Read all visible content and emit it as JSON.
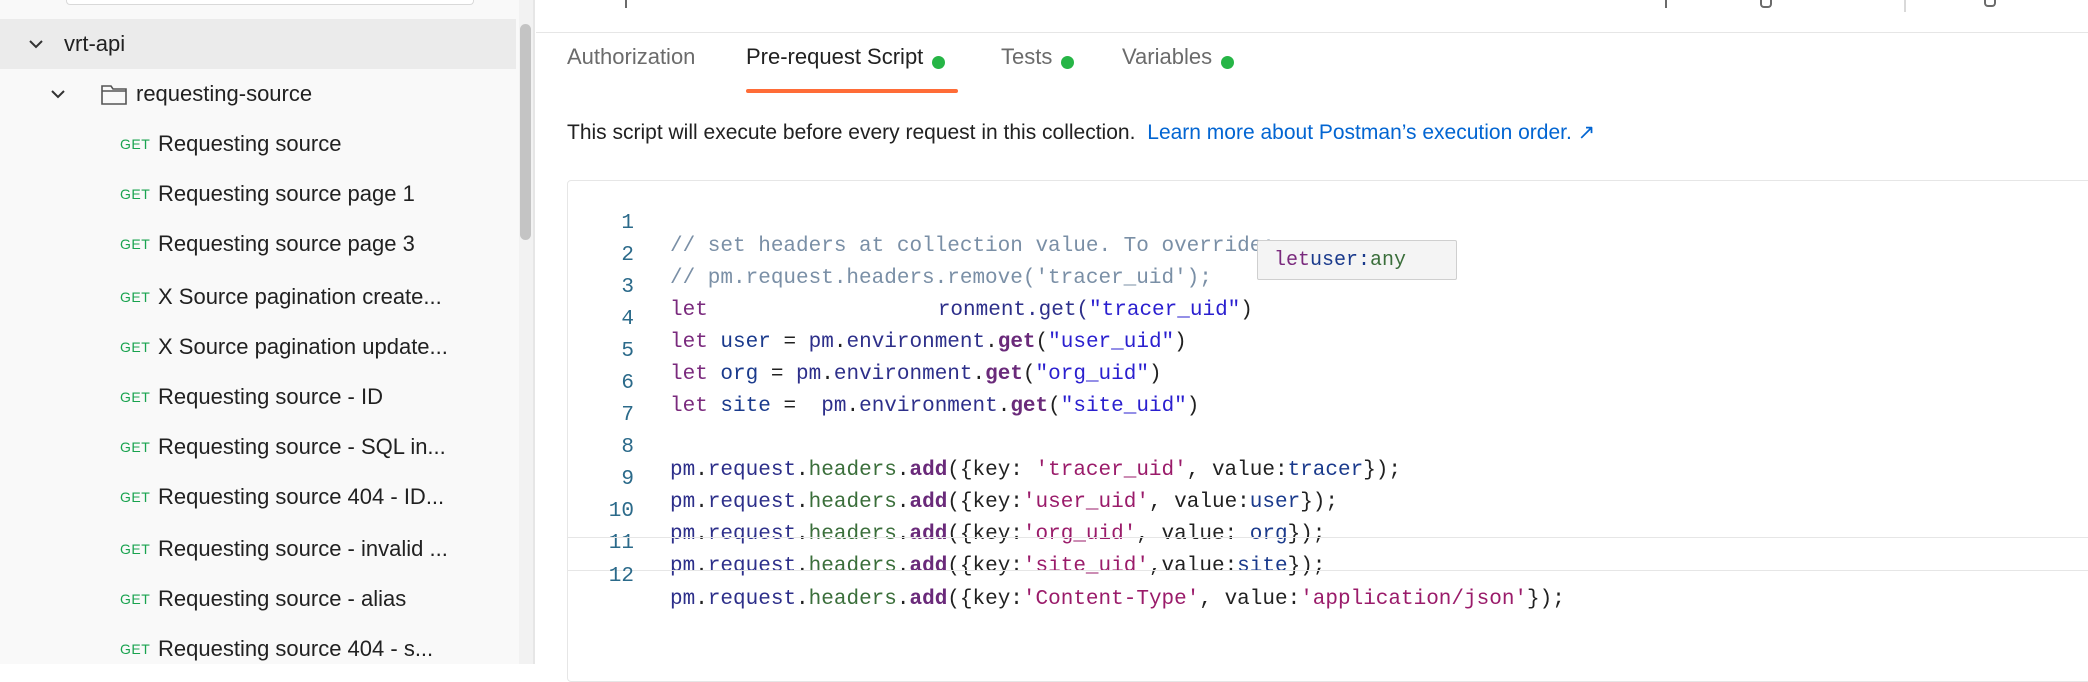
{
  "sidebar": {
    "collection": {
      "name": "vrt-api"
    },
    "folder": {
      "name": "requesting-source"
    },
    "requests": [
      {
        "method": "GET",
        "name": "Requesting source"
      },
      {
        "method": "GET",
        "name": "Requesting source page 1"
      },
      {
        "method": "GET",
        "name": "Requesting source page 3"
      },
      {
        "method": "GET",
        "name": "X Source pagination create..."
      },
      {
        "method": "GET",
        "name": "X Source pagination update..."
      },
      {
        "method": "GET",
        "name": "Requesting source - ID"
      },
      {
        "method": "GET",
        "name": "Requesting source - SQL in..."
      },
      {
        "method": "GET",
        "name": "Requesting source 404 - ID..."
      },
      {
        "method": "GET",
        "name": "Requesting source - invalid ..."
      },
      {
        "method": "GET",
        "name": "Requesting source - alias"
      },
      {
        "method": "GET",
        "name": "Requesting source 404 - s..."
      }
    ]
  },
  "tabs": [
    {
      "label": "Authorization",
      "has_dot": false
    },
    {
      "label": "Pre-request Script",
      "has_dot": true
    },
    {
      "label": "Tests",
      "has_dot": true
    },
    {
      "label": "Variables",
      "has_dot": true
    }
  ],
  "active_tab": "Pre-request Script",
  "info": {
    "text": "This script will execute before every request in this collection.",
    "link": "Learn more about Postman’s execution order. ↗"
  },
  "editor": {
    "line_numbers": [
      "1",
      "2",
      "3",
      "4",
      "5",
      "6",
      "7",
      "8",
      "9",
      "10",
      "11",
      "12"
    ],
    "tooltip": {
      "keyword": "let",
      "name": "user:",
      "type": "any"
    },
    "code": {
      "l1": "// set headers at collection value. To override:",
      "l2": "// pm.request.headers.remove('tracer_uid');",
      "l3_kw": "let",
      "l3_rest": "ronment.get(",
      "l3_str": "\"tracer_uid\"",
      "l4_var": "user",
      "l4_str": "\"user_uid\"",
      "l5_var": "org",
      "l5_str": "\"org_uid\"",
      "l6_var": "site",
      "l6_str": "\"site_uid\"",
      "l8_key": "'tracer_uid'",
      "l8_val": "tracer",
      "l9_key": "'user_uid'",
      "l9_val": "user",
      "l10_key": "'org_uid'",
      "l10_val": "org",
      "l11_key": "'site_uid'",
      "l11_val": "site",
      "l12_key": "'Content-Type'",
      "l12_val": "'application/json'"
    }
  },
  "colors": {
    "accent_tab_underline": "#ff6c37",
    "status_dot": "#26b546",
    "method_get": "#19a34f",
    "link": "#0265d2"
  }
}
